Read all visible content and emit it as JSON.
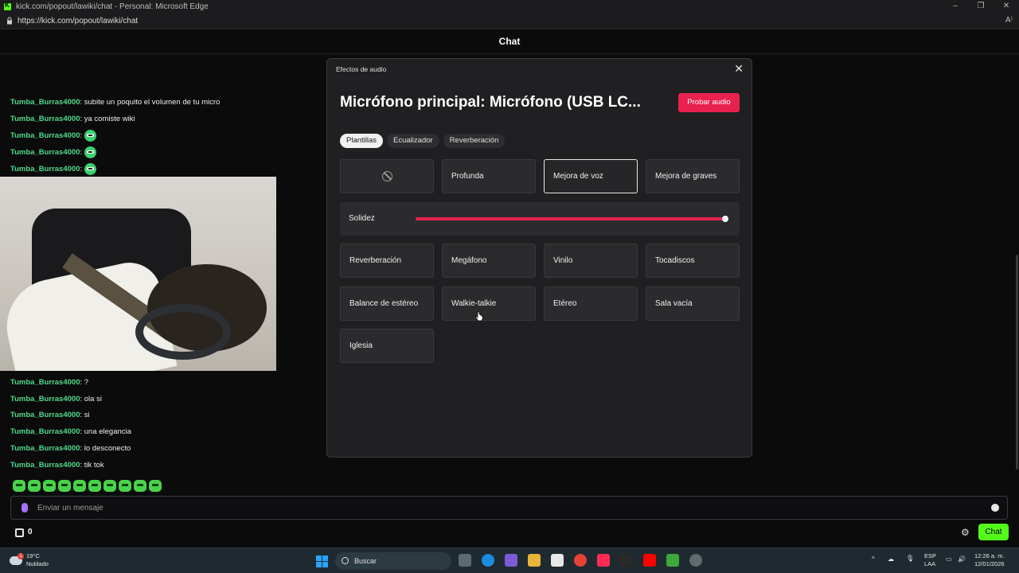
{
  "browser": {
    "window_title": "kick.com/popout/lawiki/chat - Personal: Microsoft Edge",
    "url": "https://kick.com/popout/lawiki/chat"
  },
  "chat": {
    "header_title": "Chat",
    "messages_top": [
      {
        "user": "Tumba_Burras4000",
        "text": ": subite un poquito el volumen de tu micro"
      },
      {
        "user": "Tumba_Burras4000",
        "text": ": ya comiste wiki"
      },
      {
        "user": "Tumba_Burras4000",
        "text": ":",
        "emote": "emote"
      },
      {
        "user": "Tumba_Burras4000",
        "text": ":",
        "emote": "emote"
      },
      {
        "user": "Tumba_Burras4000",
        "text": ":",
        "emote": "emote"
      }
    ],
    "messages_bottom": [
      {
        "user": "Tumba_Burras4000",
        "text": ": ?"
      },
      {
        "user": "Tumba_Burras4000",
        "text": ": ola si"
      },
      {
        "user": "Tumba_Burras4000",
        "text": ": si"
      },
      {
        "user": "Tumba_Burras4000",
        "text": ": una elegancia"
      },
      {
        "user": "Tumba_Burras4000",
        "text": ": lo desconecto"
      },
      {
        "user": "Tumba_Burras4000",
        "text": ": tik tok"
      }
    ],
    "input_placeholder": "Enviar un mensaje",
    "gift_count": "0",
    "send_label": "Chat"
  },
  "modal": {
    "title": "Efectos de audio",
    "heading": "Micrófono principal: Micrófono (USB LC...",
    "test_button": "Probar audio",
    "tabs": [
      "Plantillas",
      "Ecualizador",
      "Reverberación"
    ],
    "active_tab": "Plantillas",
    "row1": [
      "",
      "Profunda",
      "Mejora de voz",
      "Mejora de graves"
    ],
    "selected_preset": "Mejora de voz",
    "slider": {
      "label": "Solidez",
      "value_fraction": 1.0
    },
    "row2": [
      "Reverberación",
      "Megáfono",
      "Vinilo",
      "Tocadiscos"
    ],
    "row3": [
      "Balance de estéreo",
      "Walkie-talkie",
      "Etéreo",
      "Sala vacía"
    ],
    "row4": [
      "Iglesia"
    ]
  },
  "taskbar": {
    "weather_temp": "19°C",
    "weather_desc": "Nublado",
    "weather_badge": "1",
    "search_label": "Buscar",
    "lang_top": "ESP",
    "lang_bottom": "LAA",
    "time": "12:26 a. m.",
    "date": "12/01/2026"
  },
  "colors": {
    "kick_green": "#53fc18",
    "accent_red": "#e8214f",
    "username_green": "#53d98a"
  }
}
